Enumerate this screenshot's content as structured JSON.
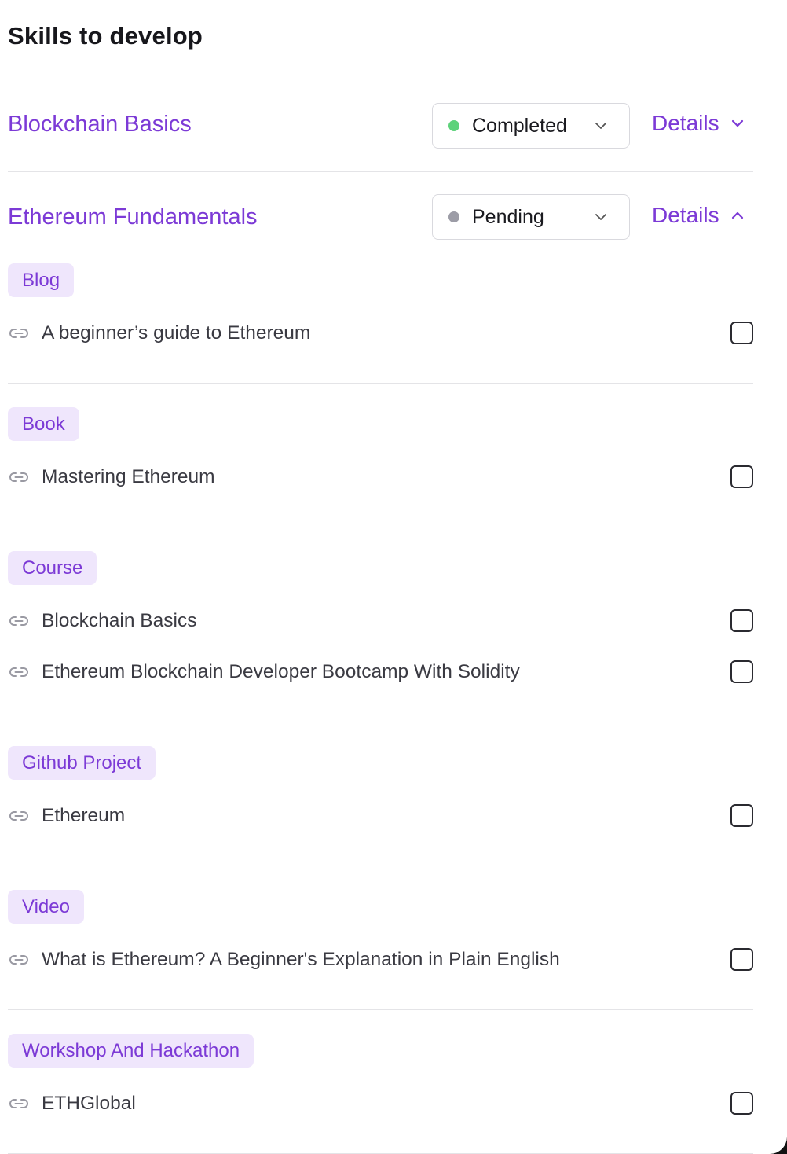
{
  "header": {
    "title": "Skills to develop"
  },
  "skills": [
    {
      "name": "Blockchain Basics",
      "status": "Completed",
      "status_color": "#5dd27a",
      "details_label": "Details",
      "expanded": false
    },
    {
      "name": "Ethereum Fundamentals",
      "status": "Pending",
      "status_color": "#9c9ca6",
      "details_label": "Details",
      "expanded": true,
      "groups": [
        {
          "tag": "Blog",
          "resources": [
            {
              "label": "A beginner’s guide to Ethereum",
              "checked": false
            }
          ]
        },
        {
          "tag": "Book",
          "resources": [
            {
              "label": "Mastering Ethereum",
              "checked": false
            }
          ]
        },
        {
          "tag": "Course",
          "resources": [
            {
              "label": "Blockchain Basics",
              "checked": false
            },
            {
              "label": "Ethereum Blockchain Developer Bootcamp With Solidity",
              "checked": false
            }
          ]
        },
        {
          "tag": "Github Project",
          "resources": [
            {
              "label": "Ethereum",
              "checked": false
            }
          ]
        },
        {
          "tag": "Video",
          "resources": [
            {
              "label": "What is Ethereum? A Beginner's Explanation in Plain English",
              "checked": false
            }
          ]
        },
        {
          "tag": "Workshop And Hackathon",
          "resources": [
            {
              "label": "ETHGlobal",
              "checked": false
            }
          ]
        }
      ]
    }
  ],
  "icons": {
    "chevron": "chevron-down-icon",
    "chevron_up": "chevron-up-icon",
    "link": "link-icon"
  },
  "colors": {
    "accent": "#7c3ad6",
    "tag_bg": "#efe6fc"
  }
}
